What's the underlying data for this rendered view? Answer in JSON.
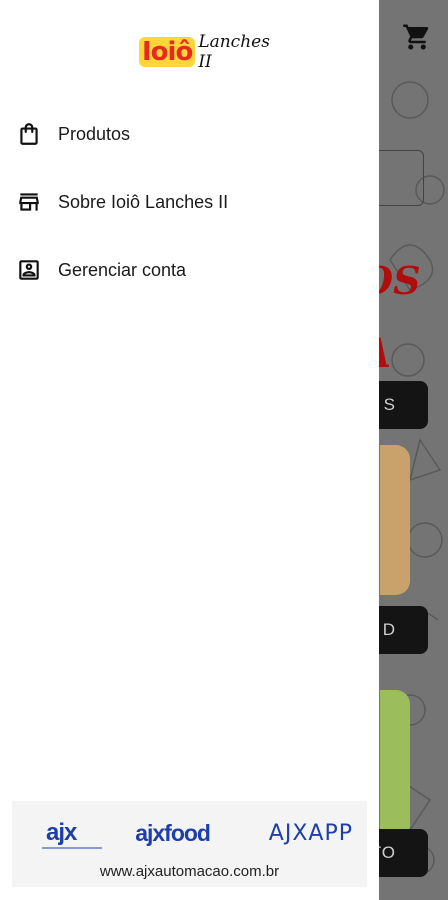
{
  "app": {
    "logo_brand": "Ioiô",
    "logo_script": "Lanches II"
  },
  "drawer": {
    "items": [
      {
        "label": "Produtos",
        "icon": "shopping-bag-icon"
      },
      {
        "label": "Sobre Ioiô Lanches II",
        "icon": "store-icon"
      },
      {
        "label": "Gerenciar conta",
        "icon": "account-box-icon"
      }
    ]
  },
  "footer": {
    "partners": [
      "ajx",
      "ajxfood",
      "AJXAPP"
    ],
    "website": "www.ajxautomacao.com.br"
  },
  "background": {
    "red_text_1": "OS",
    "red_text_2": "A",
    "button_1": "S",
    "button_2": "D",
    "button_3": "TO"
  },
  "colors": {
    "drawer_bg": "#ffffff",
    "scrim": "rgba(0,0,0,0.52)",
    "logo_red": "#e52b1f",
    "logo_yellow": "#ffd53a",
    "partner_blue": "#1f3fa8"
  }
}
